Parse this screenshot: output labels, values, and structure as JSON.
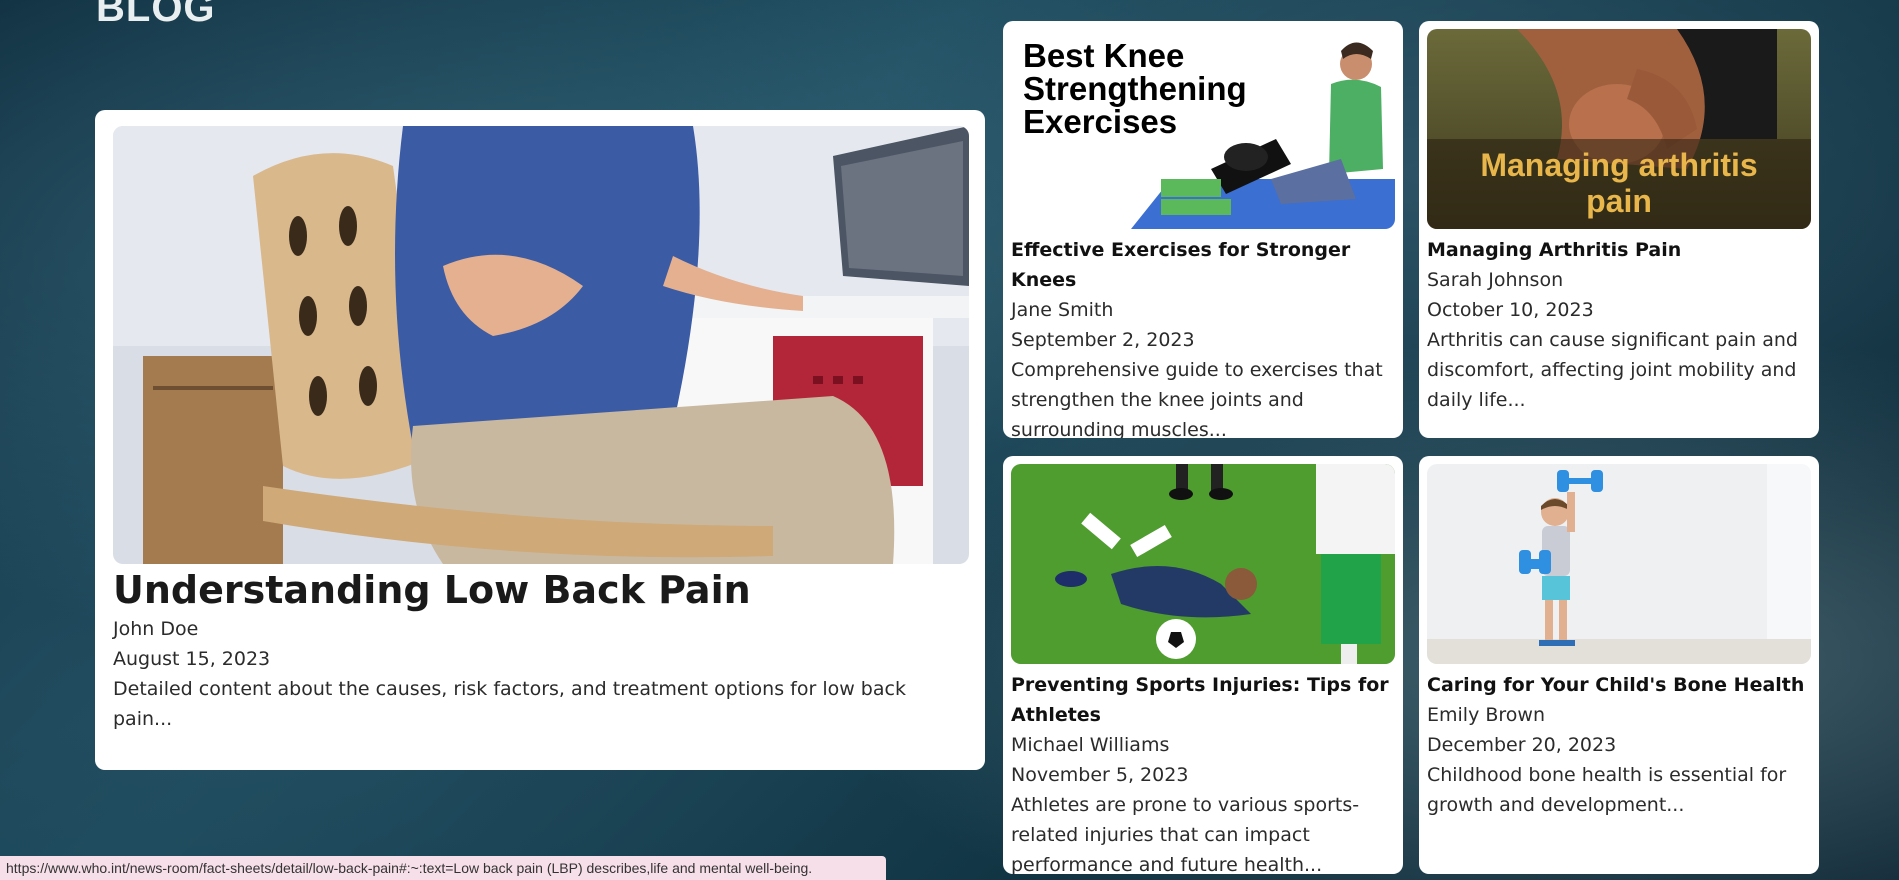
{
  "page": {
    "heading": "BLOG"
  },
  "featured": {
    "image_alt": "Woman holding lower back while sitting on wooden chair at desk",
    "title": "Understanding Low Back Pain",
    "author": "John Doe",
    "date": "August 15, 2023",
    "excerpt": "Detailed content about the causes, risk factors, and treatment options for low back pain..."
  },
  "posts": [
    {
      "image_text": [
        "Best Knee",
        "Strengthening",
        "Exercises"
      ],
      "title": "Effective Exercises for Stronger Knees",
      "author": "Jane Smith",
      "date": "September 2, 2023",
      "excerpt": "Comprehensive guide to exercises that strengthen the knee joints and surrounding muscles..."
    },
    {
      "image_text": [
        "Managing arthritis",
        "pain"
      ],
      "title": "Managing Arthritis Pain",
      "author": "Sarah Johnson",
      "date": "October 10, 2023",
      "excerpt": "Arthritis can cause significant pain and discomfort, affecting joint mobility and daily life..."
    },
    {
      "title": "Preventing Sports Injuries: Tips for Athletes",
      "author": "Michael Williams",
      "date": "November 5, 2023",
      "excerpt": "Athletes are prone to various sports-related injuries that can impact performance and future health..."
    },
    {
      "title": "Caring for Your Child's Bone Health",
      "author": "Emily Brown",
      "date": "December 20, 2023",
      "excerpt": "Childhood bone health is essential for growth and development..."
    }
  ],
  "status_bar": {
    "url": "https://www.who.int/news-room/fact-sheets/detail/low-back-pain#:~:text=Low back pain (LBP) describes,life and mental well-being."
  },
  "colors": {
    "card_bg": "#ffffff",
    "heading": "#e9eef0",
    "status_bg": "#f6dfe9",
    "arthritis_text": "#e8b64a"
  }
}
